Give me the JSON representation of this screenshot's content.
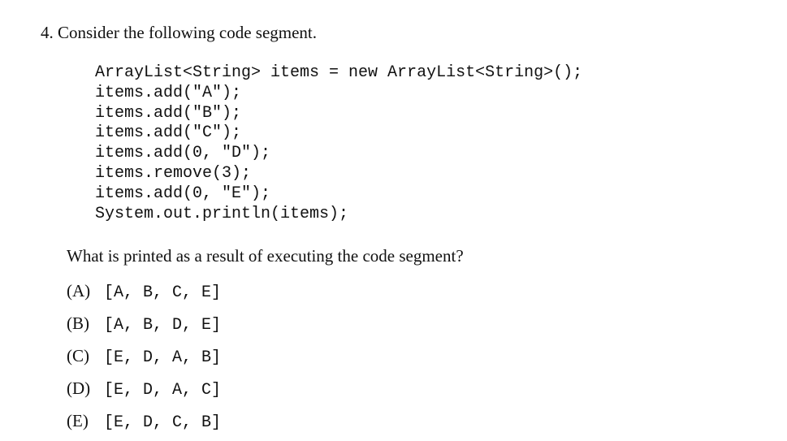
{
  "question": {
    "number": "4.",
    "text": "Consider the following code segment."
  },
  "code": [
    "ArrayList<String> items = new ArrayList<String>();",
    "items.add(\"A\");",
    "items.add(\"B\");",
    "items.add(\"C\");",
    "items.add(0, \"D\");",
    "items.remove(3);",
    "items.add(0, \"E\");",
    "System.out.println(items);"
  ],
  "prompt": "What is printed as a result of executing the code segment?",
  "options": [
    {
      "label": "(A)",
      "value": "[A, B, C, E]"
    },
    {
      "label": "(B)",
      "value": "[A, B, D, E]"
    },
    {
      "label": "(C)",
      "value": "[E, D, A, B]"
    },
    {
      "label": "(D)",
      "value": "[E, D, A, C]"
    },
    {
      "label": "(E)",
      "value": "[E, D, C, B]"
    }
  ]
}
